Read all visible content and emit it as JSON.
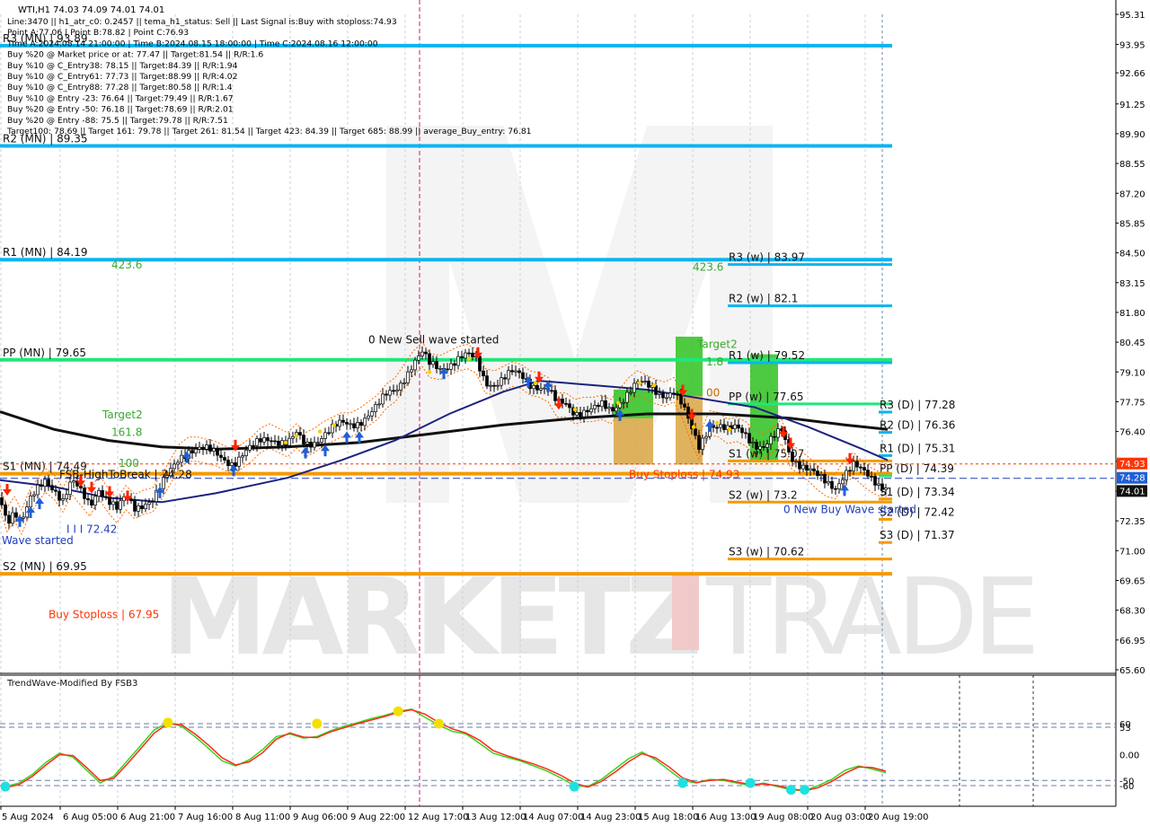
{
  "header": {
    "symbol_line": "WTI,H1  74.03 74.09 74.01 74.01",
    "info_lines": [
      "Line:3470 || h1_atr_c0: 0.2457 || tema_h1_status: Sell || Last Signal is:Buy with stoploss:74.93",
      "Point A:77.06 | Point B:78.82 | Point C:76.93",
      "Time A:2024.08.14 21:00:00 | Time B:2024.08.15 18:00:00 | Time C:2024.08.16 12:00:00",
      "Buy %20 @ Market price or at: 77.47 || Target:81.54 || R/R:1.6",
      "Buy %10 @ C_Entry38: 78.15 || Target:84.39 || R/R:1.94",
      "Buy %10 @ C_Entry61: 77.73 || Target:88.99 || R/R:4.02",
      "Buy %10 @ C_Entry88: 77.28 || Target:80.58 || R/R:1.4",
      "Buy %10 @ Entry -23: 76.64 || Target:79.49 || R/R:1.67",
      "Buy %20 @ Entry -50: 76.18 || Target:78.69 || R/R:2.01",
      "Buy %20 @ Entry -88: 75.5 || Target:79.78 || R/R:7.51",
      "Target100: 78.69 || Target 161: 79.78 || Target 261: 81.54 || Target 423: 84.39 || Target 685: 88.99 || average_Buy_entry: 76.81"
    ]
  },
  "watermark": {
    "brand_left": "MARKETZ",
    "brand_right": "TRADE"
  },
  "chart_data": [
    {
      "type": "candlestick",
      "title": "WTI,H1",
      "ylim": [
        65.6,
        95.31
      ],
      "y_ticks": [
        "95.31",
        "93.95",
        "92.66",
        "91.25",
        "89.90",
        "88.55",
        "87.20",
        "85.85",
        "84.50",
        "83.15",
        "81.80",
        "80.45",
        "79.10",
        "77.75",
        "76.40",
        "75.05",
        "73.70",
        "72.35",
        "71.00",
        "69.65",
        "68.30",
        "66.95",
        "65.60"
      ],
      "x_ticks": [
        "5 Aug 2024",
        "6 Aug 05:00",
        "6 Aug 21:00",
        "7 Aug 16:00",
        "8 Aug 11:00",
        "9 Aug 06:00",
        "9 Aug 22:00",
        "12 Aug 17:00",
        "13 Aug 12:00",
        "14 Aug 07:00",
        "14 Aug 23:00",
        "15 Aug 18:00",
        "16 Aug 13:00",
        "19 Aug 08:00",
        "20 Aug 03:00",
        "20 Aug 19:00"
      ],
      "current_price_label": "74.01",
      "price_tags": [
        {
          "value": 74.93,
          "label": "74.93",
          "color": "#ff3300"
        },
        {
          "value": 74.28,
          "label": "74.28",
          "color": "#1f5fd6"
        },
        {
          "value": 74.01,
          "label": "74.01",
          "color": "#111111"
        }
      ],
      "close_path": [
        [
          0,
          73.4
        ],
        [
          8,
          72.4
        ],
        [
          16,
          72.9
        ],
        [
          24,
          72.3
        ],
        [
          32,
          73.1
        ],
        [
          40,
          73.6
        ],
        [
          50,
          74.2
        ],
        [
          60,
          73.9
        ],
        [
          70,
          73.3
        ],
        [
          80,
          74.1
        ],
        [
          90,
          73.6
        ],
        [
          100,
          73.1
        ],
        [
          110,
          73.9
        ],
        [
          120,
          73.3
        ],
        [
          130,
          72.8
        ],
        [
          140,
          73.4
        ],
        [
          150,
          73.0
        ],
        [
          160,
          73.2
        ],
        [
          170,
          73.3
        ],
        [
          180,
          73.9
        ],
        [
          190,
          74.6
        ],
        [
          200,
          75.3
        ],
        [
          210,
          75.6
        ],
        [
          220,
          75.6
        ],
        [
          230,
          75.5
        ],
        [
          240,
          75.4
        ],
        [
          250,
          75.2
        ],
        [
          260,
          75.0
        ],
        [
          270,
          75.3
        ],
        [
          280,
          75.6
        ],
        [
          290,
          76.0
        ],
        [
          300,
          76.2
        ],
        [
          310,
          76.0
        ],
        [
          320,
          75.8
        ],
        [
          330,
          76.2
        ],
        [
          340,
          75.8
        ],
        [
          350,
          76.0
        ],
        [
          360,
          76.3
        ],
        [
          370,
          76.5
        ],
        [
          380,
          76.7
        ],
        [
          390,
          76.7
        ],
        [
          400,
          76.9
        ],
        [
          410,
          77.2
        ],
        [
          420,
          77.5
        ],
        [
          430,
          78.0
        ],
        [
          440,
          78.3
        ],
        [
          450,
          78.9
        ],
        [
          460,
          79.5
        ],
        [
          470,
          79.9
        ],
        [
          478,
          79.4
        ],
        [
          490,
          79.3
        ],
        [
          500,
          79.5
        ],
        [
          510,
          79.7
        ],
        [
          520,
          79.8
        ],
        [
          530,
          79.6
        ],
        [
          540,
          78.7
        ],
        [
          550,
          78.6
        ],
        [
          560,
          78.8
        ],
        [
          570,
          79.0
        ],
        [
          580,
          78.9
        ],
        [
          590,
          78.6
        ],
        [
          600,
          78.5
        ],
        [
          610,
          78.3
        ],
        [
          620,
          77.6
        ],
        [
          630,
          77.6
        ],
        [
          640,
          77.3
        ],
        [
          650,
          77.4
        ],
        [
          660,
          77.4
        ],
        [
          670,
          77.5
        ],
        [
          680,
          77.3
        ],
        [
          690,
          77.8
        ],
        [
          700,
          78.3
        ],
        [
          710,
          78.6
        ],
        [
          720,
          78.4
        ],
        [
          730,
          78.2
        ],
        [
          740,
          78.1
        ],
        [
          750,
          78.3
        ],
        [
          760,
          77.5
        ],
        [
          770,
          76.4
        ],
        [
          778,
          75.7
        ],
        [
          790,
          76.8
        ],
        [
          800,
          76.7
        ],
        [
          810,
          76.4
        ],
        [
          820,
          76.5
        ],
        [
          830,
          76.3
        ],
        [
          840,
          75.9
        ],
        [
          850,
          75.7
        ],
        [
          860,
          76.0
        ],
        [
          870,
          76.4
        ],
        [
          880,
          75.3
        ],
        [
          890,
          75.0
        ],
        [
          900,
          74.7
        ],
        [
          910,
          74.3
        ],
        [
          920,
          74.0
        ],
        [
          930,
          73.9
        ],
        [
          940,
          74.6
        ],
        [
          950,
          74.9
        ],
        [
          960,
          74.5
        ],
        [
          970,
          74.2
        ],
        [
          980,
          74.0
        ],
        [
          988,
          74.01
        ]
      ],
      "indicators": {
        "ma_black": [
          [
            0,
            77.3
          ],
          [
            60,
            76.5
          ],
          [
            120,
            76.0
          ],
          [
            180,
            75.7
          ],
          [
            240,
            75.6
          ],
          [
            320,
            75.7
          ],
          [
            400,
            75.9
          ],
          [
            480,
            76.3
          ],
          [
            560,
            76.7
          ],
          [
            640,
            77.0
          ],
          [
            720,
            77.2
          ],
          [
            800,
            77.2
          ],
          [
            880,
            77.0
          ],
          [
            940,
            76.7
          ],
          [
            988,
            76.5
          ]
        ],
        "ma_navy": [
          [
            0,
            74.2
          ],
          [
            60,
            73.9
          ],
          [
            120,
            73.4
          ],
          [
            180,
            73.2
          ],
          [
            240,
            73.6
          ],
          [
            320,
            74.3
          ],
          [
            380,
            75.1
          ],
          [
            440,
            76.0
          ],
          [
            500,
            77.2
          ],
          [
            560,
            78.2
          ],
          [
            600,
            78.7
          ],
          [
            660,
            78.5
          ],
          [
            720,
            78.3
          ],
          [
            780,
            77.9
          ],
          [
            840,
            77.5
          ],
          [
            900,
            76.6
          ],
          [
            960,
            75.6
          ],
          [
            988,
            75.1
          ]
        ]
      },
      "levels": [
        {
          "label": "R3 (MN) | 93.89",
          "value": 93.89,
          "color": "#0db4ef",
          "x_range": [
            0,
            993
          ]
        },
        {
          "label": "R2 (MN) | 89.35",
          "value": 89.35,
          "color": "#0db4ef",
          "x_range": [
            0,
            993
          ]
        },
        {
          "label": "R1 (MN) | 84.19",
          "value": 84.19,
          "color": "#0db4ef",
          "x_range": [
            0,
            993
          ]
        },
        {
          "label": "PP (MN) | 79.65",
          "value": 79.65,
          "color": "#1ee87a",
          "x_range": [
            0,
            993
          ]
        },
        {
          "label": "S1 (MN) | 74.49",
          "value": 74.49,
          "color": "#f59a00",
          "x_range": [
            0,
            993
          ]
        },
        {
          "label": "S2 (MN) | 69.95",
          "value": 69.95,
          "color": "#f59a00",
          "x_range": [
            0,
            993
          ]
        },
        {
          "label": "R3 (w) | 83.97",
          "value": 83.97,
          "color": "#0db4ef",
          "x_range": [
            810,
            993
          ]
        },
        {
          "label": "R2 (w) | 82.1",
          "value": 82.1,
          "color": "#0db4ef",
          "x_range": [
            810,
            993
          ]
        },
        {
          "label": "R1 (w) | 79.52",
          "value": 79.52,
          "color": "#0db4ef",
          "x_range": [
            810,
            993
          ]
        },
        {
          "label": "PP (w) | 77.65",
          "value": 77.65,
          "color": "#1ee87a",
          "x_range": [
            810,
            993
          ]
        },
        {
          "label": "S1 (w) | 75.07",
          "value": 75.07,
          "color": "#f59a00",
          "x_range": [
            810,
            993
          ]
        },
        {
          "label": "S2 (w) | 73.2",
          "value": 73.2,
          "color": "#f59a00",
          "x_range": [
            810,
            993
          ]
        },
        {
          "label": "S3 (w) | 70.62",
          "value": 70.62,
          "color": "#f59a00",
          "x_range": [
            810,
            993
          ]
        },
        {
          "label": "R3 (D) | 77.28",
          "value": 77.28,
          "color": "#0db4ef",
          "x_range": [
            978,
            993
          ]
        },
        {
          "label": "R2 (D) | 76.36",
          "value": 76.36,
          "color": "#0db4ef",
          "x_range": [
            978,
            993
          ]
        },
        {
          "label": "R1 (D) | 75.31",
          "value": 75.31,
          "color": "#0db4ef",
          "x_range": [
            978,
            993
          ]
        },
        {
          "label": "PP (D) | 74.39",
          "value": 74.39,
          "color": "#1ee87a",
          "x_range": [
            978,
            993
          ]
        },
        {
          "label": "S1 (D) | 73.34",
          "value": 73.34,
          "color": "#f59a00",
          "x_range": [
            978,
            993
          ]
        },
        {
          "label": "S2 (D) | 72.42",
          "value": 72.42,
          "color": "#f59a00",
          "x_range": [
            978,
            993
          ]
        },
        {
          "label": "S3 (D) | 71.37",
          "value": 71.37,
          "color": "#f59a00",
          "x_range": [
            978,
            993
          ]
        }
      ],
      "annotations": [
        {
          "text": "0 New Sell wave started",
          "value": 80.4,
          "color": "#111111"
        },
        {
          "text": "0 New Buy Wave started",
          "value": 72.7,
          "color": "#1f3fbf"
        },
        {
          "text": "Wave started",
          "value": 71.3,
          "color": "#1f3fbf"
        },
        {
          "text": "Target2",
          "value": 77.0,
          "color": "#3aa832"
        },
        {
          "text": "161.8",
          "value": 76.2,
          "color": "#3aa832"
        },
        {
          "text": "100",
          "value": 74.8,
          "color": "#3aa832"
        },
        {
          "text": "423.6",
          "value": 83.8,
          "color": "#3aa832"
        },
        {
          "text": "423.6",
          "value": 83.7,
          "color": "#3aa832"
        },
        {
          "text": "Target2",
          "value": 80.2,
          "color": "#3aa832"
        },
        {
          "text": "1.8",
          "value": 79.4,
          "color": "#3aa832"
        },
        {
          "text": "00",
          "value": 78.0,
          "color": "#c26b00"
        },
        {
          "text": "FSB-HighToBreak | 74.28",
          "value": 74.28,
          "color": "#111111"
        },
        {
          "text": "Buy Stoploss | 74.93",
          "value": 74.28,
          "color": "#ff3300"
        },
        {
          "text": "Buy Stoploss | 67.95",
          "value": 67.95,
          "color": "#ff3300"
        },
        {
          "text": "I I I 72.42",
          "value": 71.8,
          "color": "#1f3fbf"
        }
      ],
      "zones": [
        {
          "color": "#2fc21f",
          "from": 77.0,
          "to": 78.3,
          "kind": "green-top"
        },
        {
          "color": "#d9a441",
          "from": 74.9,
          "to": 77.0,
          "kind": "tan-bottom"
        },
        {
          "color": "#2fc21f",
          "from": 78.0,
          "to": 80.7,
          "kind": "green-top"
        },
        {
          "color": "#d9a441",
          "from": 74.9,
          "to": 78.0,
          "kind": "tan-bottom"
        },
        {
          "color": "#2fc21f",
          "from": 75.0,
          "to": 79.9,
          "kind": "green"
        }
      ]
    },
    {
      "type": "line",
      "title": "TrendWave-Modified By FSB3",
      "ylim": [
        -100,
        100
      ],
      "y_ticks": [
        "60",
        "53",
        "0.00",
        "-50",
        "-60"
      ],
      "hlines": [
        53,
        60,
        -50,
        -60
      ],
      "series": [
        {
          "color": "#3ad41e",
          "values": [
            -62,
            -55,
            -38,
            -15,
            3,
            -5,
            -30,
            -55,
            -42,
            -12,
            18,
            48,
            62,
            55,
            35,
            12,
            -12,
            -22,
            -10,
            10,
            35,
            40,
            32,
            35,
            46,
            55,
            62,
            70,
            76,
            84,
            88,
            72,
            57,
            45,
            40,
            22,
            3,
            -5,
            -12,
            -22,
            -32,
            -45,
            -60,
            -62,
            -48,
            -28,
            -8,
            5,
            -10,
            -30,
            -50,
            -55,
            -48,
            -50,
            -55,
            -60,
            -55,
            -62,
            -68,
            -70,
            -60,
            -48,
            -30,
            -22,
            -28,
            -35
          ]
        },
        {
          "color": "#ff2a1a",
          "values": [
            -64,
            -58,
            -42,
            -20,
            0,
            -2,
            -25,
            -50,
            -46,
            -18,
            12,
            42,
            60,
            58,
            40,
            18,
            -6,
            -20,
            -14,
            4,
            30,
            42,
            34,
            33,
            44,
            52,
            60,
            67,
            74,
            82,
            87,
            78,
            62,
            50,
            42,
            28,
            8,
            -2,
            -10,
            -18,
            -28,
            -40,
            -55,
            -63,
            -52,
            -34,
            -14,
            2,
            -6,
            -24,
            -45,
            -54,
            -50,
            -48,
            -53,
            -58,
            -57,
            -60,
            -66,
            -70,
            -64,
            -52,
            -36,
            -24,
            -25,
            -32
          ]
        }
      ],
      "markers": [
        {
          "index": 0,
          "value": -62,
          "color": "#1ee0e0"
        },
        {
          "index": 12,
          "value": 62,
          "color": "#f4e000"
        },
        {
          "index": 23,
          "value": 60,
          "color": "#f4e000"
        },
        {
          "index": 29,
          "value": 84,
          "color": "#f4e000"
        },
        {
          "index": 32,
          "value": 60,
          "color": "#f4e000"
        },
        {
          "index": 42,
          "value": -62,
          "color": "#1ee0e0"
        },
        {
          "index": 50,
          "value": -55,
          "color": "#1ee0e0"
        },
        {
          "index": 55,
          "value": -55,
          "color": "#1ee0e0"
        },
        {
          "index": 58,
          "value": -68,
          "color": "#1ee0e0"
        },
        {
          "index": 59,
          "value": -68,
          "color": "#1ee0e0"
        }
      ]
    }
  ]
}
